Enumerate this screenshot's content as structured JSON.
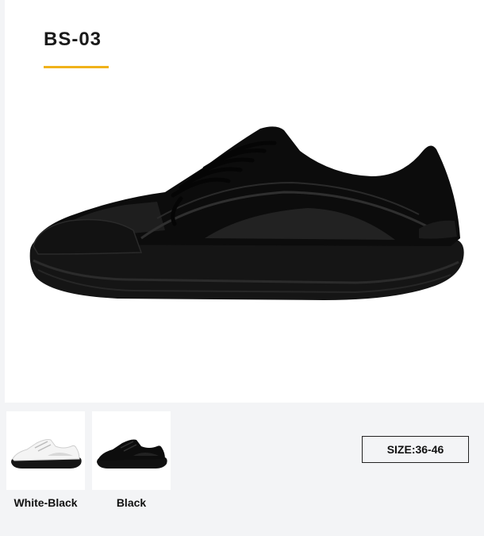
{
  "product": {
    "model": "BS-03",
    "accent_color": "#f0b21a"
  },
  "main_image": {
    "icon": "black-sneaker-side-view"
  },
  "variants": [
    {
      "label": "White-Black",
      "icon": "white-sneaker-thumbnail"
    },
    {
      "label": "Black",
      "icon": "black-sneaker-thumbnail"
    }
  ],
  "size": {
    "label": "SIZE:36-46"
  }
}
